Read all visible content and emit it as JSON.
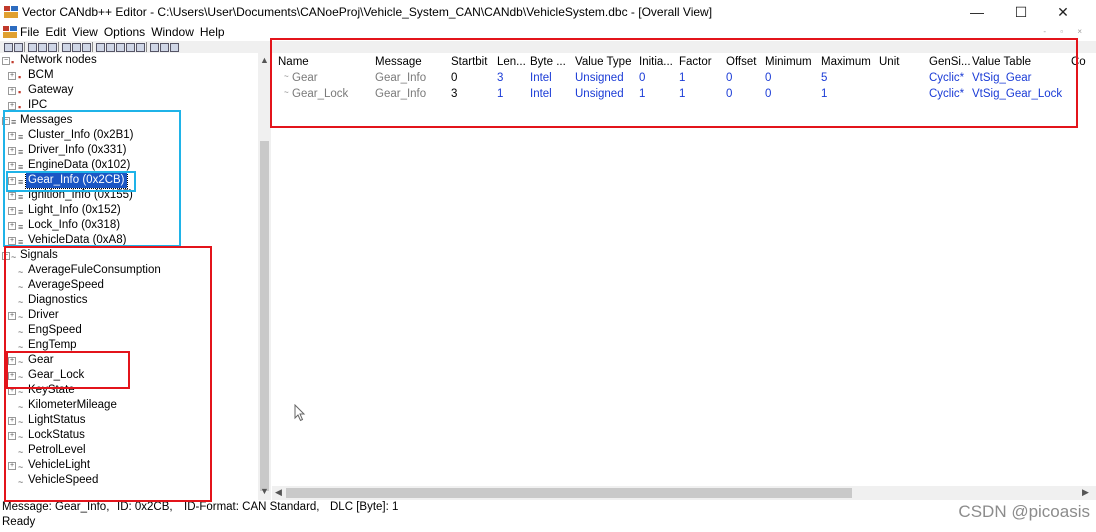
{
  "window": {
    "title": "Vector CANdb++ Editor - C:\\Users\\User\\Documents\\CANoeProj\\Vehicle_System_CAN\\CANdb\\VehicleSystem.dbc - [Overall View]",
    "controls": {
      "minimize": "—",
      "maximize": "☐",
      "close": "✕"
    }
  },
  "menu": [
    "File",
    "Edit",
    "View",
    "Options",
    "Window",
    "Help"
  ],
  "tree": {
    "network_nodes": {
      "label": "Network nodes",
      "items": [
        "BCM",
        "Gateway",
        "IPC"
      ]
    },
    "messages": {
      "label": "Messages",
      "items": [
        "Cluster_Info (0x2B1)",
        "Driver_Info (0x331)",
        "EngineData (0x102)",
        "Gear_Info (0x2CB)",
        "Ignition_Info (0x155)",
        "Light_Info (0x152)",
        "Lock_Info (0x318)",
        "VehicleData (0xA8)"
      ],
      "selected": "Gear_Info (0x2CB)"
    },
    "signals": {
      "label": "Signals",
      "items": [
        "AverageFuleConsumption",
        "AverageSpeed",
        "Diagnostics",
        "Driver",
        "EngSpeed",
        "EngTemp",
        "Gear",
        "Gear_Lock",
        "KeyState",
        "KilometerMileage",
        "LightStatus",
        "LockStatus",
        "PetrolLevel",
        "VehicleLight",
        "VehicleSpeed"
      ]
    }
  },
  "table": {
    "columns": [
      "Name",
      "Message",
      "Startbit",
      "Len...",
      "Byte ...",
      "Value Type",
      "Initia...",
      "Factor",
      "Offset",
      "Minimum",
      "Maximum",
      "Unit",
      "GenSi...",
      "Value Table",
      "Co"
    ],
    "rows": [
      {
        "name": "Gear",
        "message": "Gear_Info",
        "startbit": "0",
        "length": "3",
        "byte_order": "Intel",
        "value_type": "Unsigned",
        "initial": "0",
        "factor": "1",
        "offset": "0",
        "minimum": "0",
        "maximum": "5",
        "unit": "",
        "gensig": "Cyclic*",
        "value_table": "VtSig_Gear"
      },
      {
        "name": "Gear_Lock",
        "message": "Gear_Info",
        "startbit": "3",
        "length": "1",
        "byte_order": "Intel",
        "value_type": "Unsigned",
        "initial": "1",
        "factor": "1",
        "offset": "0",
        "minimum": "0",
        "maximum": "1",
        "unit": "",
        "gensig": "Cyclic*",
        "value_table": "VtSig_Gear_Lock"
      }
    ]
  },
  "status": {
    "message": "Message: Gear_Info,",
    "id": "ID: 0x2CB,",
    "id_format": "ID-Format: CAN Standard,",
    "dlc": "DLC [Byte]: 1",
    "state": "Ready"
  },
  "watermark": "CSDN @picoasis",
  "colors": {
    "annotation_red": "#e3141b",
    "annotation_cyan": "#1fb3e8",
    "selection": "#1b56c4",
    "value_blue": "#1a3bd6"
  }
}
